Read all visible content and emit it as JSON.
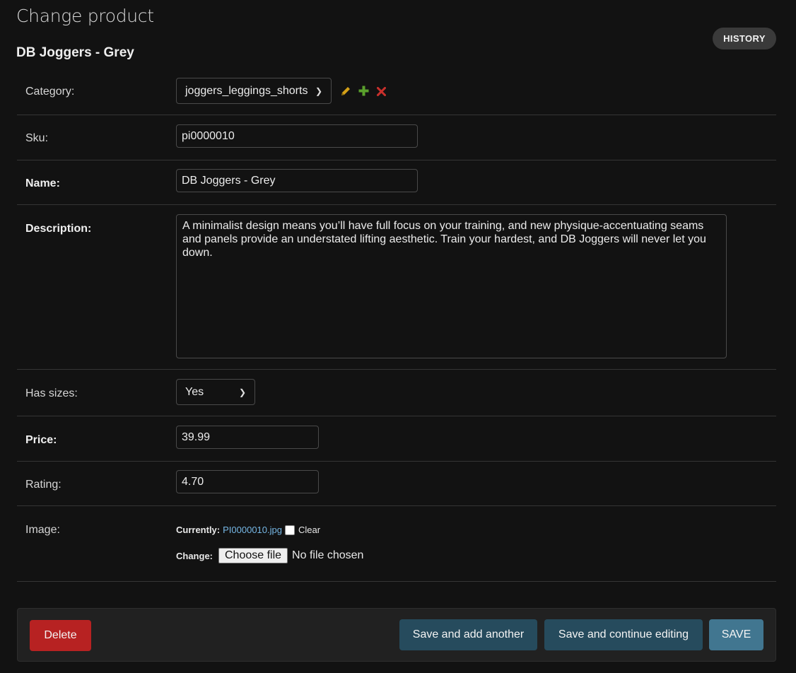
{
  "page": {
    "title": "Change product",
    "object_title": "DB Joggers - Grey",
    "history_label": "HISTORY"
  },
  "form": {
    "category": {
      "label": "Category:",
      "value": "joggers_leggings_shorts"
    },
    "sku": {
      "label": "Sku:",
      "value": "pi0000010"
    },
    "name": {
      "label": "Name:",
      "value": "DB Joggers - Grey"
    },
    "description": {
      "label": "Description:",
      "value": "A minimalist design means you’ll have full focus on your training, and new physique-accentuating seams and panels provide an understated lifting aesthetic. Train your hardest, and DB Joggers will never let you down."
    },
    "has_sizes": {
      "label": "Has sizes:",
      "value": "Yes"
    },
    "price": {
      "label": "Price:",
      "value": "39.99"
    },
    "rating": {
      "label": "Rating:",
      "value": "4.70"
    },
    "image": {
      "label": "Image:",
      "currently_label": "Currently:",
      "current_file": "PI0000010.jpg",
      "clear_label": "Clear",
      "change_label": "Change:",
      "choose_file_label": "Choose file",
      "no_file_label": "No file chosen"
    }
  },
  "actions": {
    "delete_label": "Delete",
    "save_add_label": "Save and add another",
    "save_continue_label": "Save and continue editing",
    "save_label": "SAVE"
  },
  "icons": {
    "edit": "pencil-icon",
    "add": "plus-icon",
    "remove": "close-icon"
  },
  "colors": {
    "background": "#121212",
    "link": "#76b7e5",
    "delete": "#b72222",
    "secondary_button": "#264b5d",
    "primary_button": "#417690",
    "edit_icon": "#d4a017",
    "add_icon": "#5aa02c",
    "remove_icon": "#c9302c"
  }
}
